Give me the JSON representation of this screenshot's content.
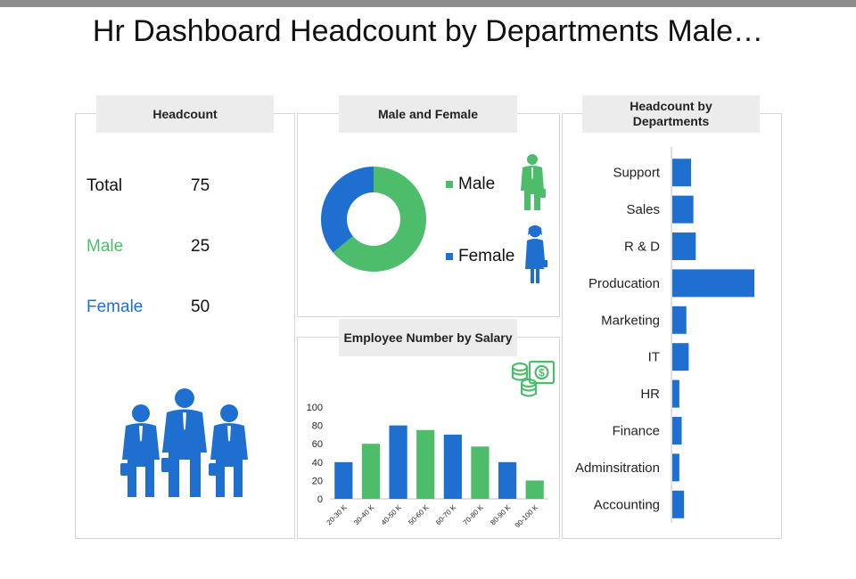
{
  "page": {
    "title": "Hr Dashboard Headcount by Departments Male…"
  },
  "colors": {
    "blue": "#1f6fd1",
    "green": "#4dbd6c",
    "panel_header": "#ececec",
    "border": "#d6d6d6"
  },
  "headcount_panel": {
    "title": "Headcount",
    "rows": [
      {
        "label": "Total",
        "value": "75"
      },
      {
        "label": "Male",
        "value": "25"
      },
      {
        "label": "Female",
        "value": "50"
      }
    ],
    "icon": "business-people-group-icon"
  },
  "gender_panel": {
    "title": "Male and Female",
    "legend": [
      {
        "label": "Male",
        "icon": "businessman-icon"
      },
      {
        "label": "Female",
        "icon": "businesswoman-icon"
      }
    ]
  },
  "salary_panel": {
    "title": "Employee Number by Salary",
    "icon": "money-coins-icon"
  },
  "departments_panel": {
    "title": "Headcount by Departments"
  },
  "chart_data": [
    {
      "type": "pie",
      "categories": [
        "Male",
        "Female"
      ],
      "values": [
        64,
        36
      ],
      "donut": true,
      "colors": [
        "#4dbd6c",
        "#1f6fd1"
      ]
    },
    {
      "type": "bar",
      "categories": [
        "20-30  K",
        "30-40  K",
        "40-50  K",
        "50-60  K",
        "60-70  K",
        "70-80  K",
        "80-90  K",
        "90-100  K"
      ],
      "values": [
        40,
        60,
        80,
        75,
        70,
        57,
        40,
        20
      ],
      "colors": [
        "#1f6fd1",
        "#4dbd6c",
        "#1f6fd1",
        "#4dbd6c",
        "#1f6fd1",
        "#4dbd6c",
        "#1f6fd1",
        "#4dbd6c"
      ],
      "yticks": [
        "0",
        "20",
        "40",
        "60",
        "80",
        "100"
      ],
      "ylim": [
        0,
        100
      ],
      "grid": false
    },
    {
      "type": "bar",
      "orientation": "horizontal",
      "categories": [
        "Support",
        "Sales",
        "R & D",
        "Producation",
        "Marketing",
        "IT",
        "HR",
        "Finance",
        "Adminsitration",
        "Accounting"
      ],
      "values": [
        8,
        9,
        10,
        35,
        6,
        7,
        3,
        4,
        3,
        5
      ],
      "color": "#1f6fd1",
      "grid": false
    }
  ]
}
